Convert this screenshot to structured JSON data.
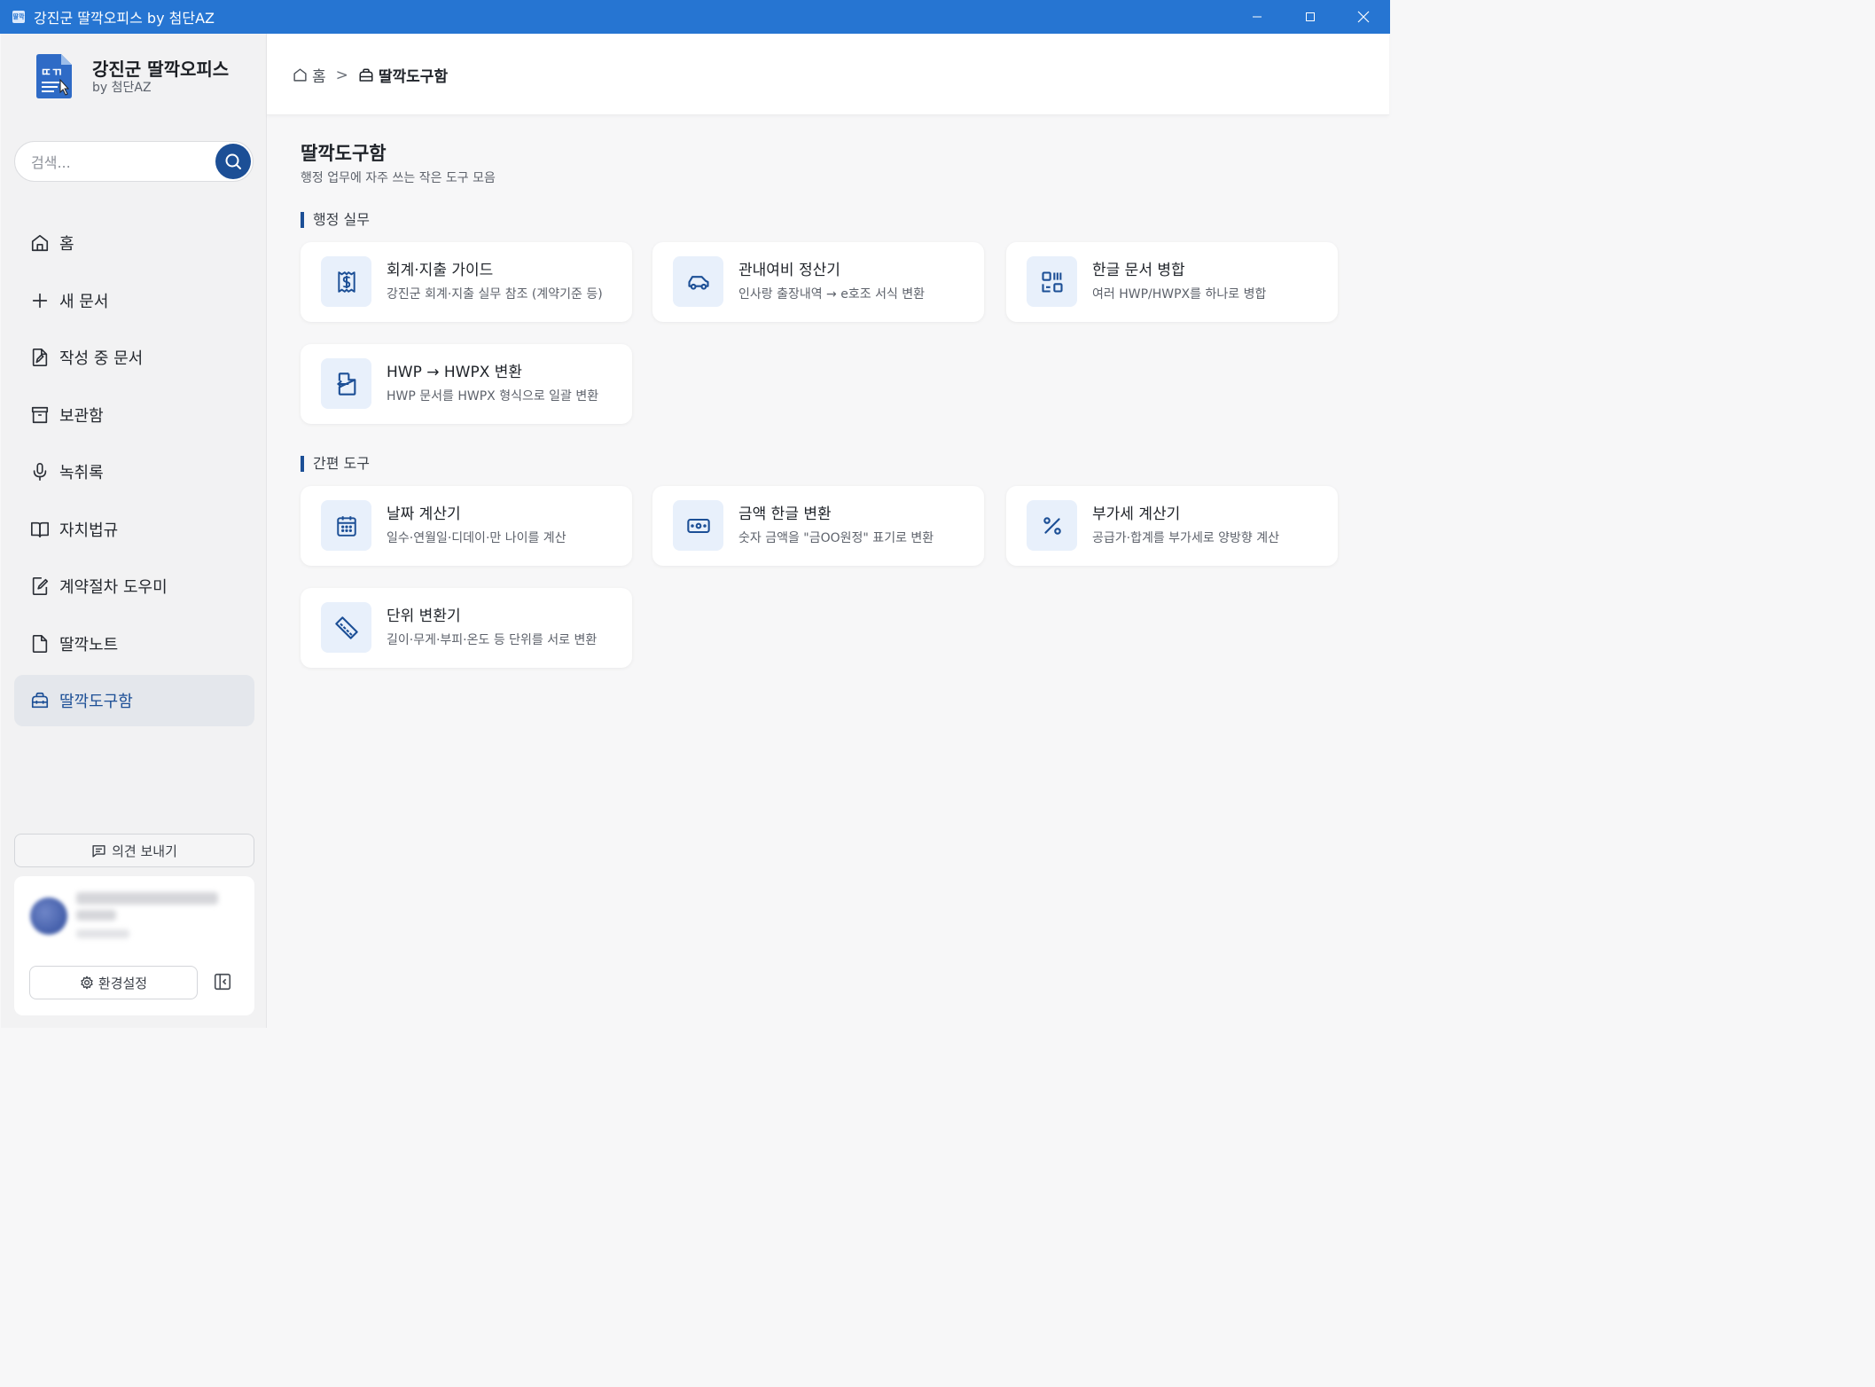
{
  "window": {
    "title": "강진군 딸깍오피스 by 첨단AZ",
    "app_icon_text": "딸깍"
  },
  "brand": {
    "title": "강진군 딸깍오피스",
    "subtitle": "by 첨단AZ",
    "logo_text": "ㄸㄲ"
  },
  "search": {
    "placeholder": "검색...",
    "value": ""
  },
  "sidebar": {
    "items": [
      {
        "label": "홈",
        "icon": "home-icon"
      },
      {
        "label": "새 문서",
        "icon": "plus-icon"
      },
      {
        "label": "작성 중 문서",
        "icon": "file-edit-icon"
      },
      {
        "label": "보관함",
        "icon": "archive-icon"
      },
      {
        "label": "녹취록",
        "icon": "microphone-icon"
      },
      {
        "label": "자치법규",
        "icon": "book-icon"
      },
      {
        "label": "계약절차 도우미",
        "icon": "contract-icon"
      },
      {
        "label": "딸깍노트",
        "icon": "note-icon"
      },
      {
        "label": "딸깍도구함",
        "icon": "toolbox-icon",
        "active": true
      }
    ],
    "feedback_label": "의견 보내기",
    "settings_label": "환경설정"
  },
  "breadcrumb": {
    "home": "홈",
    "separator": ">",
    "current": "딸깍도구함"
  },
  "page": {
    "title": "딸깍도구함",
    "description": "행정 업무에 자주 쓰는 작은 도구 모음"
  },
  "sections": [
    {
      "label": "행정 실무",
      "cards": [
        {
          "title": "회계·지출 가이드",
          "desc": "강진군 회계·지출 실무 참조 (계약기준 등)",
          "icon": "receipt-dollar-icon"
        },
        {
          "title": "관내여비 정산기",
          "desc": "인사랑 출장내역 → e호조 서식 변환",
          "icon": "car-icon"
        },
        {
          "title": "한글 문서 병합",
          "desc": "여러 HWP/HWPX를 하나로 병합",
          "icon": "merge-icon"
        },
        {
          "title": "HWP → HWPX 변환",
          "desc": "HWP 문서를 HWPX 형식으로 일괄 변환",
          "icon": "file-convert-icon"
        }
      ]
    },
    {
      "label": "간편 도구",
      "cards": [
        {
          "title": "날짜 계산기",
          "desc": "일수·연월일·디데이·만 나이를 계산",
          "icon": "calendar-icon"
        },
        {
          "title": "금액 한글 변환",
          "desc": "숫자 금액을 \"금OO원정\" 표기로 변환",
          "icon": "banknote-icon"
        },
        {
          "title": "부가세 계산기",
          "desc": "공급가·합계를 부가세로 양방향 계산",
          "icon": "percent-icon"
        },
        {
          "title": "단위 변환기",
          "desc": "길이·무게·부피·온도 등 단위를 서로 변환",
          "icon": "ruler-icon"
        }
      ]
    }
  ],
  "colors": {
    "titlebar": "#2675d2",
    "accent": "#1c4f96",
    "icon_bg": "#e8f0fb",
    "active_nav_bg": "#e4e7ec"
  }
}
